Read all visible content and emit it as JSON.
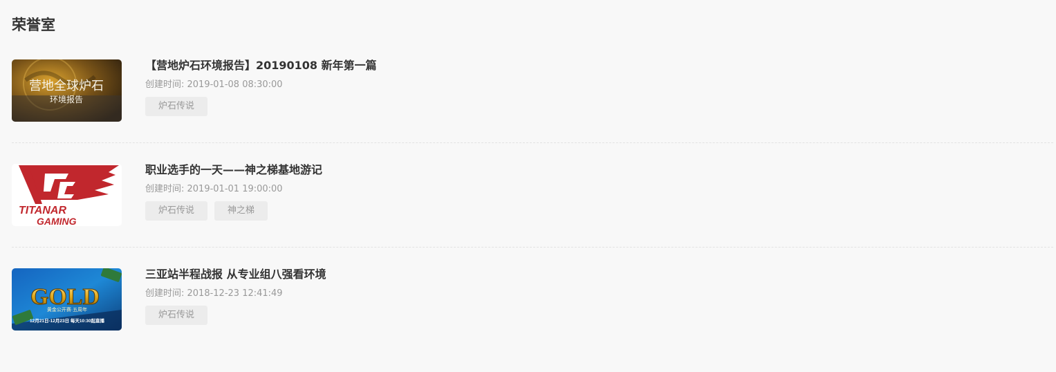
{
  "section": {
    "title": "荣誉室"
  },
  "articles": [
    {
      "thumb_text_main": "营地全球炉石",
      "thumb_text_sub": "环境报告",
      "title": "【营地炉石环境报告】20190108 新年第一篇",
      "created": "创建时间: 2019-01-08 08:30:00",
      "tags": [
        "炉石传说"
      ]
    },
    {
      "thumb_text_main": "TITANAR",
      "thumb_text_sub": "GAMING",
      "title": "职业选手的一天——神之梯基地游记",
      "created": "创建时间: 2019-01-01 19:00:00",
      "tags": [
        "炉石传说",
        "神之梯"
      ]
    },
    {
      "thumb_text_main": "GOLD",
      "thumb_text_sub": "黄金公开赛·五周年",
      "thumb_text_date": "12月21日-12月23日 每天10:30起直播",
      "title": "三亚站半程战报 从专业组八强看环境",
      "created": "创建时间: 2018-12-23 12:41:49",
      "tags": [
        "炉石传说"
      ]
    }
  ],
  "colors": {
    "background": "#f8f8f8",
    "tag_bg": "#ececec",
    "titanar_red": "#c1272d",
    "gold_blue": "#1e88d6"
  }
}
